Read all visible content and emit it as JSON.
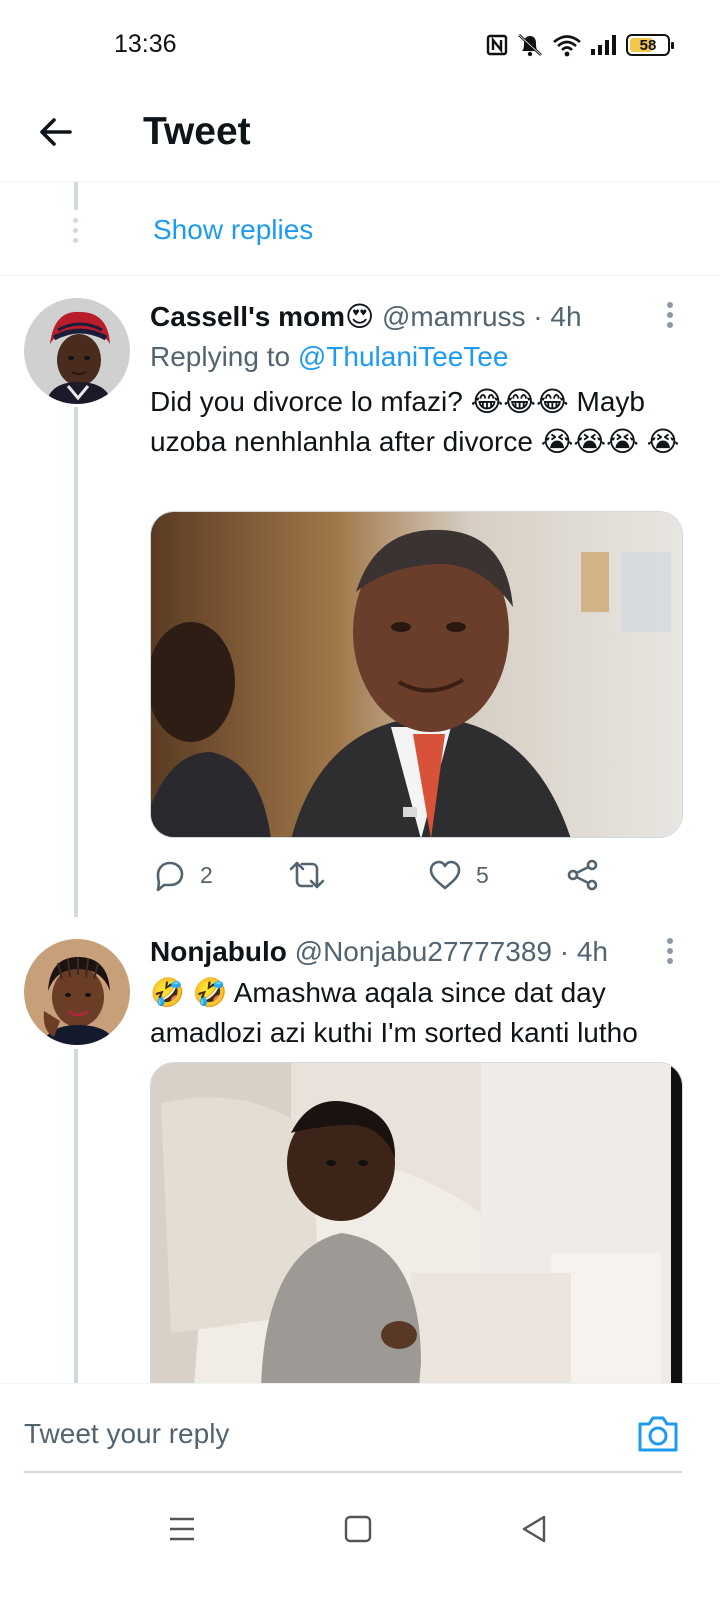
{
  "status_bar": {
    "time": "13:36",
    "battery": "58",
    "icons": [
      "nfc-icon",
      "mute-icon",
      "wifi-icon",
      "signal-icon",
      "battery-icon"
    ]
  },
  "header": {
    "title": "Tweet"
  },
  "prev_thread": {
    "show_replies": "Show replies"
  },
  "tweets": [
    {
      "name": "Cassell's mom",
      "name_emoji": "😍",
      "handle": "@mamruss",
      "time": "· 4h",
      "replying_prefix": "Replying to",
      "replying_handle": "@ThulaniTeeTee",
      "text": "Did you divorce lo mfazi? 😂😂😂 Mayb uzoba nenhlanhla after divorce 😭😭😭 😭",
      "media": "photo",
      "replies": "2",
      "retweets": "",
      "likes": "5"
    },
    {
      "name": "Nonjabulo",
      "name_emoji": "",
      "handle": "@Nonjabu27777389",
      "time": "· 4h",
      "text": "🤣 🤣 Amashwa aqala since dat day amadlozi azi kuthi I'm sorted kanti lutho",
      "media": "photo"
    }
  ],
  "reply_bar": {
    "placeholder": "Tweet your reply"
  },
  "nav_bar": {
    "buttons": [
      "menu",
      "home",
      "back"
    ]
  },
  "colors": {
    "accent": "#1d9bf0",
    "secondary_text": "#536471",
    "divider": "#eff3f4",
    "thread_line": "#cfd9de"
  }
}
